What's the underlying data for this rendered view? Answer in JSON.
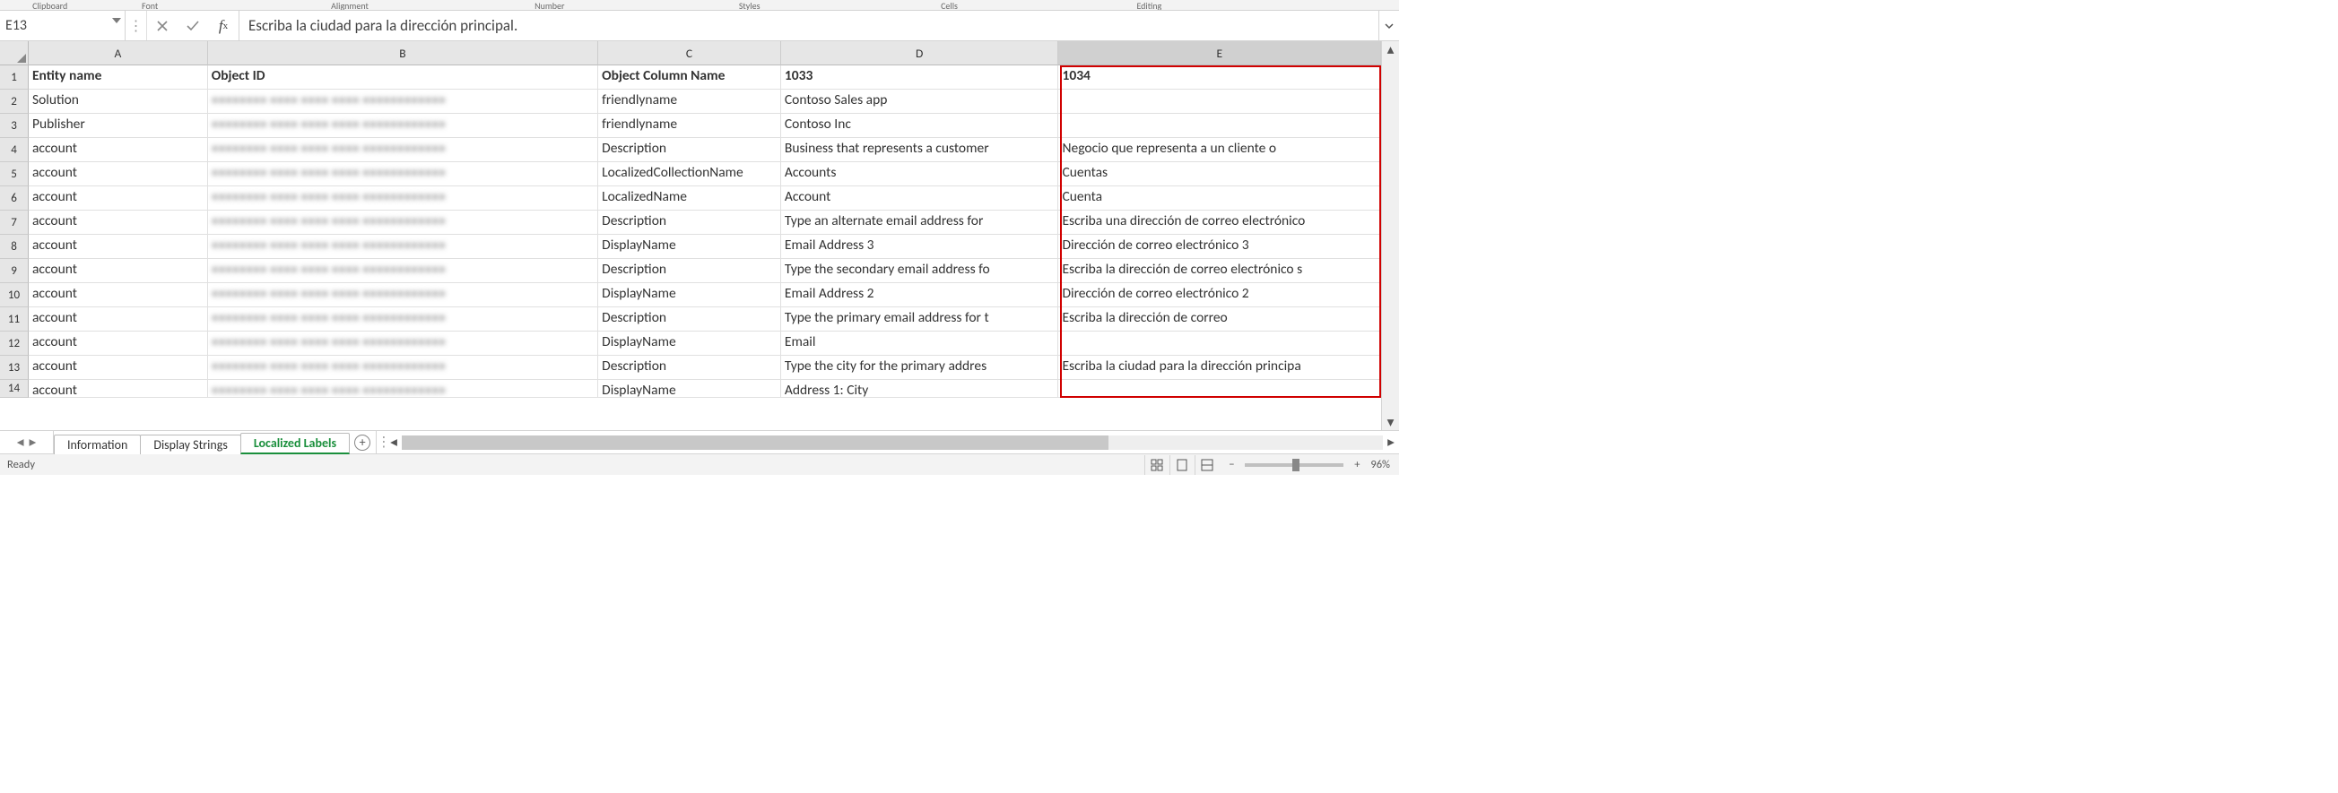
{
  "ribbon_groups": [
    "Clipboard",
    "Font",
    "",
    "Alignment",
    "",
    "Number",
    "",
    "Styles",
    "",
    "Cells",
    "",
    "Editing",
    "",
    ""
  ],
  "name_box": "E13",
  "formula_bar_value": "Escriba la ciudad para la dirección principal.",
  "columns": [
    "A",
    "B",
    "C",
    "D",
    "E"
  ],
  "headers": {
    "A": "Entity name",
    "B": "Object ID",
    "C": "Object Column Name",
    "D": "1033",
    "E": "1034"
  },
  "rows": [
    {
      "n": 2,
      "A": "Solution",
      "C": "friendlyname",
      "D": "Contoso Sales app",
      "E": ""
    },
    {
      "n": 3,
      "A": "Publisher",
      "C": "friendlyname",
      "D": "Contoso Inc",
      "E": ""
    },
    {
      "n": 4,
      "A": "account",
      "C": "Description",
      "D": "Business that represents a customer",
      "E": "Negocio que representa a un cliente o"
    },
    {
      "n": 5,
      "A": "account",
      "C": "LocalizedCollectionName",
      "D": "Accounts",
      "E": "Cuentas"
    },
    {
      "n": 6,
      "A": "account",
      "C": "LocalizedName",
      "D": "Account",
      "E": "Cuenta"
    },
    {
      "n": 7,
      "A": "account",
      "C": "Description",
      "D": "Type an alternate email address for",
      "E": "Escriba una dirección de correo electrónico"
    },
    {
      "n": 8,
      "A": "account",
      "C": "DisplayName",
      "D": "Email Address 3",
      "E": "Dirección de correo electrónico 3"
    },
    {
      "n": 9,
      "A": "account",
      "C": "Description",
      "D": "Type the secondary email address fo",
      "E": "Escriba la dirección de correo electrónico s"
    },
    {
      "n": 10,
      "A": "account",
      "C": "DisplayName",
      "D": "Email Address 2",
      "E": "Dirección de correo electrónico 2"
    },
    {
      "n": 11,
      "A": "account",
      "C": "Description",
      "D": "Type the primary email address for t",
      "E": "Escriba la dirección de correo"
    },
    {
      "n": 12,
      "A": "account",
      "C": "DisplayName",
      "D": "Email",
      "E": ""
    },
    {
      "n": 13,
      "A": "account",
      "C": "Description",
      "D": "Type the city for the primary addres",
      "E": "Escriba la ciudad para la dirección principa"
    },
    {
      "n": 14,
      "A": "account",
      "C": "DisplayName",
      "D": "Address 1: City",
      "E": ""
    }
  ],
  "object_id_placeholder": "••••••••  ••••  ••••  ••••  ••••••••••••",
  "sheet_tabs": {
    "items": [
      "Information",
      "Display Strings",
      "Localized Labels"
    ],
    "active": "Localized Labels"
  },
  "status": {
    "left": "Ready",
    "zoom": "96%"
  }
}
